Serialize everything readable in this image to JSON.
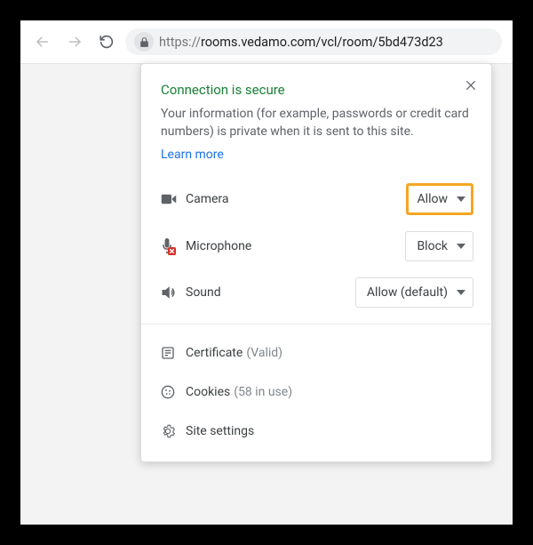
{
  "address_bar": {
    "protocol": "https://",
    "url_rest": "rooms.vedamo.com/vcl/room/5bd473d23"
  },
  "popup": {
    "title": "Connection is secure",
    "description": "Your information (for example, passwords or credit card numbers) is private when it is sent to this site.",
    "learn_more": "Learn more",
    "permissions": [
      {
        "label": "Camera",
        "value": "Allow",
        "highlight": true
      },
      {
        "label": "Microphone",
        "value": "Block",
        "highlight": false
      },
      {
        "label": "Sound",
        "value": "Allow (default)",
        "highlight": false
      }
    ],
    "info": {
      "certificate": {
        "label": "Certificate",
        "status": "(Valid)"
      },
      "cookies": {
        "label": "Cookies",
        "status": "(58 in use)"
      },
      "settings": {
        "label": "Site settings"
      }
    }
  }
}
